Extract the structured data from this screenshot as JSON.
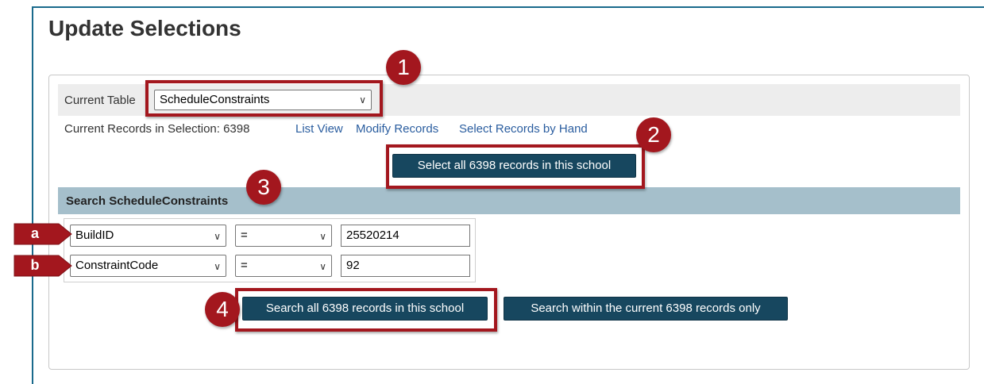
{
  "page": {
    "title": "Update Selections"
  },
  "current_table": {
    "label": "Current Table",
    "value": "ScheduleConstraints"
  },
  "records": {
    "label": "Current Records in Selection: 6398",
    "links": [
      "List View",
      "Modify Records",
      "Select Records by Hand"
    ]
  },
  "buttons": {
    "select_all": "Select all 6398 records in this school",
    "search_all": "Search all 6398 records in this school",
    "search_within": "Search within the current 6398 records only"
  },
  "search": {
    "header": "Search ScheduleConstraints",
    "rows": [
      {
        "field": "BuildID",
        "operator": "=",
        "value": "25520214"
      },
      {
        "field": "ConstraintCode",
        "operator": "=",
        "value": "92"
      }
    ]
  },
  "annotations": {
    "numbers": [
      "1",
      "2",
      "3",
      "4"
    ],
    "letters": [
      "a",
      "b"
    ],
    "color": "#a3171e"
  }
}
